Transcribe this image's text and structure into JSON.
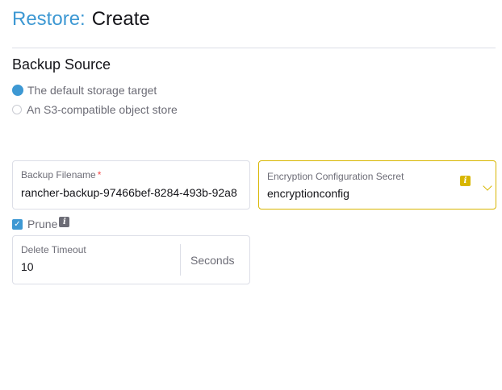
{
  "header": {
    "crumb": "Restore:",
    "title": "Create"
  },
  "backup_source": {
    "title": "Backup Source",
    "options": [
      {
        "label": "The default storage target",
        "checked": true
      },
      {
        "label": "An S3-compatible object store",
        "checked": false
      }
    ]
  },
  "backup_filename": {
    "label": "Backup Filename",
    "required_mark": "*",
    "value": "rancher-backup-97466bef-8284-493b-92a8"
  },
  "encryption_secret": {
    "label": "Encryption Configuration Secret",
    "value": "encryptionconfig",
    "info_icon": "i",
    "accent": "#d8b600"
  },
  "prune": {
    "label": "Prune",
    "checked": true,
    "info_icon": "i"
  },
  "delete_timeout": {
    "label": "Delete Timeout",
    "value": "10",
    "suffix": "Seconds"
  },
  "colors": {
    "primary": "#3d98d3",
    "warning": "#d8b600",
    "required": "#f64747"
  }
}
